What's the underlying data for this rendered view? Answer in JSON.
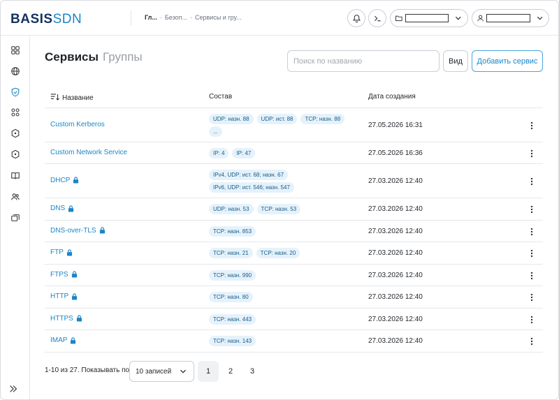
{
  "header": {
    "logo_main": "BASIS",
    "logo_accent": "SDN",
    "breadcrumbs": [
      "Гл...",
      "Безоп...",
      "Сервисы и гру..."
    ]
  },
  "main": {
    "tabs": [
      {
        "label": "Сервисы",
        "active": true
      },
      {
        "label": "Группы",
        "active": false
      }
    ],
    "search": {
      "placeholder": "Поиск по названию",
      "value": ""
    },
    "view_label": "Вид",
    "add_label": "Добавить сервис",
    "columns": {
      "name": "Название",
      "composition": "Состав",
      "created": "Дата создания"
    },
    "rows": [
      {
        "name": "Custom Kerberos",
        "locked": false,
        "tags": [
          "UDP: назн. 88",
          "UDP: ист. 88",
          "TCP: назн. 88",
          "..."
        ],
        "date": "27.05.2026 16:31"
      },
      {
        "name": "Custom Network Service",
        "locked": false,
        "tags": [
          "IP: 4",
          "IP: 47"
        ],
        "date": "27.05.2026 16:36"
      },
      {
        "name": "DHCP",
        "locked": true,
        "tags": [
          "IPv4, UDP: ист. 68; назн. 67",
          "IPv6, UDP: ист. 546; назн. 547"
        ],
        "date": "27.03.2026 12:40"
      },
      {
        "name": "DNS",
        "locked": true,
        "tags": [
          "UDP: назн. 53",
          "TCP: назн. 53"
        ],
        "date": "27.03.2026 12:40"
      },
      {
        "name": "DNS-over-TLS",
        "locked": true,
        "tags": [
          "TCP: назн. 853"
        ],
        "date": "27.03.2026 12:40"
      },
      {
        "name": "FTP",
        "locked": true,
        "tags": [
          "TCP: назн. 21",
          "TCP: назн. 20"
        ],
        "date": "27.03.2026 12:40"
      },
      {
        "name": "FTPS",
        "locked": true,
        "tags": [
          "TCP: назн. 990"
        ],
        "date": "27.03.2026 12:40"
      },
      {
        "name": "HTTP",
        "locked": true,
        "tags": [
          "TCP: назн. 80"
        ],
        "date": "27.03.2026 12:40"
      },
      {
        "name": "HTTPS",
        "locked": true,
        "tags": [
          "TCP: назн. 443"
        ],
        "date": "27.03.2026 12:40"
      },
      {
        "name": "IMAP",
        "locked": true,
        "tags": [
          "TCP: назн. 143"
        ],
        "date": "27.03.2026 12:40"
      }
    ]
  },
  "pagination": {
    "info": "1-10 из 27. Показывать по",
    "per_page": "10 записей",
    "pages": [
      "1",
      "2",
      "3"
    ],
    "current": "1"
  },
  "colors": {
    "accent": "#1a86c8",
    "tag_bg": "#e5f2fb",
    "brand": "#15315e"
  },
  "icons": {
    "sidebar": [
      "dashboard-icon",
      "globe-icon",
      "shield-icon",
      "apps-icon",
      "hexagon-icon",
      "hexagon-dot-icon",
      "book-icon",
      "users-icon",
      "stack-icon"
    ],
    "header": [
      "bell-icon",
      "terminal-icon",
      "folder-icon",
      "user-icon"
    ]
  }
}
